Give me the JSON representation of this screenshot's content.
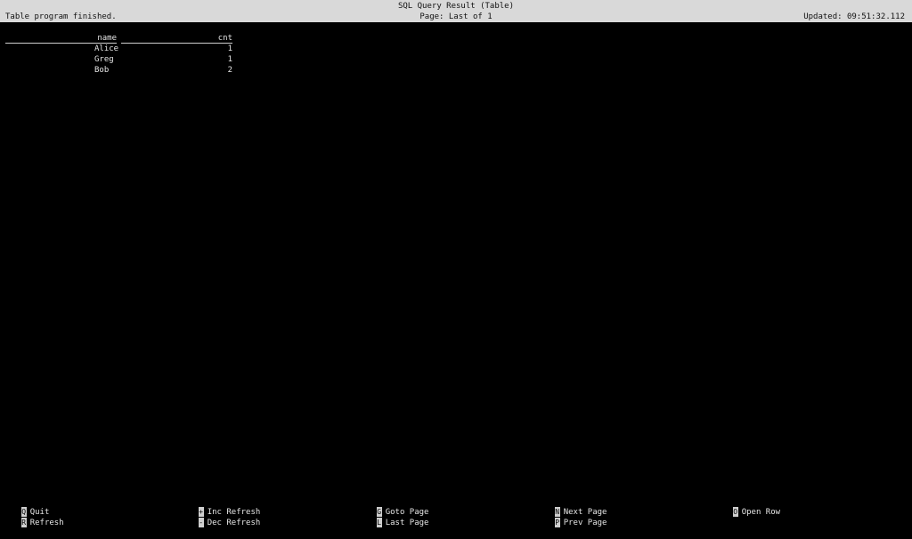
{
  "header": {
    "title": "SQL Query Result (Table)",
    "status": "Table program finished.",
    "page": "Page: Last of 1",
    "updated": "Updated: 09:51:32.112"
  },
  "table": {
    "columns": [
      "name",
      "cnt"
    ],
    "rows": [
      {
        "name": "Alice",
        "cnt": "1"
      },
      {
        "name": "Greg",
        "cnt": "1"
      },
      {
        "name": "Bob",
        "cnt": "2"
      }
    ]
  },
  "footer": {
    "keys": [
      {
        "key": "Q",
        "label": "Quit"
      },
      {
        "key": "R",
        "label": "Refresh"
      },
      {
        "key": "+",
        "label": "Inc Refresh"
      },
      {
        "key": "-",
        "label": "Dec Refresh"
      },
      {
        "key": "G",
        "label": "Goto Page"
      },
      {
        "key": "L",
        "label": "Last Page"
      },
      {
        "key": "N",
        "label": "Next Page"
      },
      {
        "key": "P",
        "label": "Prev Page"
      },
      {
        "key": "O",
        "label": "Open Row"
      }
    ]
  }
}
